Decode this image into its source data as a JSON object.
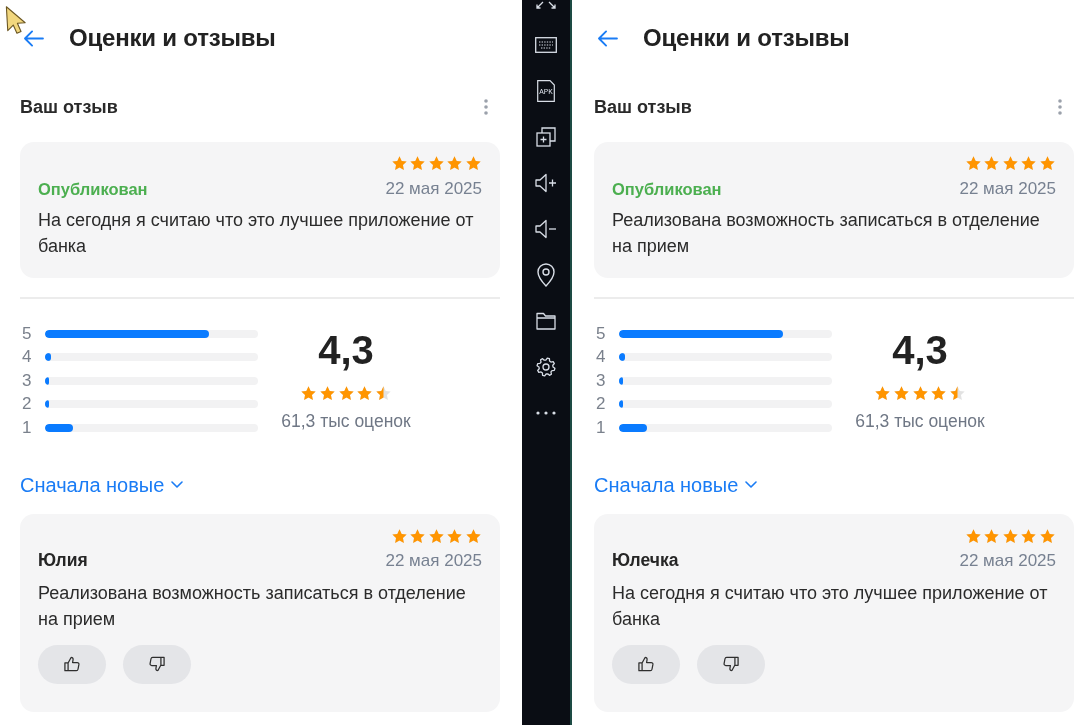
{
  "left_screen": {
    "header": {
      "title": "Оценки и отзывы"
    },
    "my_review": {
      "heading": "Ваш отзыв",
      "stars": 5,
      "status": "Опубликован",
      "date": "22 мая 2025",
      "text": "На сегодня я считаю что это лучшее приложение от банка"
    },
    "summary": {
      "distribution": [
        {
          "label": "5",
          "level": 0.77
        },
        {
          "label": "4",
          "level": 0.03
        },
        {
          "label": "3",
          "level": 0.02
        },
        {
          "label": "2",
          "level": 0.02
        },
        {
          "label": "1",
          "level": 0.13
        }
      ],
      "average": "4,3",
      "stars": 4.5,
      "count": "61,3 тыс оценок"
    },
    "sort": {
      "label": "Сначала новые"
    },
    "reviews": [
      {
        "author": "Юлия",
        "stars": 5,
        "date": "22 мая 2025",
        "text": "Реализована возможность записаться в отделение на прием"
      }
    ]
  },
  "emulator_toolbar": {
    "items": [
      {
        "kind": "expand"
      },
      {
        "kind": "keyboard"
      },
      {
        "kind": "apk",
        "label": "APK"
      },
      {
        "kind": "multi_window"
      },
      {
        "kind": "volume_up"
      },
      {
        "kind": "volume_down"
      },
      {
        "kind": "location"
      },
      {
        "kind": "folder"
      },
      {
        "kind": "settings"
      },
      {
        "kind": "more"
      }
    ]
  },
  "right_screen": {
    "header": {
      "title": "Оценки и отзывы"
    },
    "my_review": {
      "heading": "Ваш отзыв",
      "stars": 5,
      "status": "Опубликован",
      "date": "22 мая 2025",
      "text": "Реализована возможность записаться в отделение на прием"
    },
    "summary": {
      "distribution": [
        {
          "label": "5",
          "level": 0.77
        },
        {
          "label": "4",
          "level": 0.03
        },
        {
          "label": "3",
          "level": 0.02
        },
        {
          "label": "2",
          "level": 0.02
        },
        {
          "label": "1",
          "level": 0.13
        }
      ],
      "average": "4,3",
      "stars": 4.5,
      "count": "61,3 тыс оценок"
    },
    "sort": {
      "label": "Сначала новые"
    },
    "reviews": [
      {
        "author": "Юлечка",
        "stars": 5,
        "date": "22 мая 2025",
        "text": "На сегодня я считаю что это лучшее приложение от банка"
      }
    ]
  }
}
